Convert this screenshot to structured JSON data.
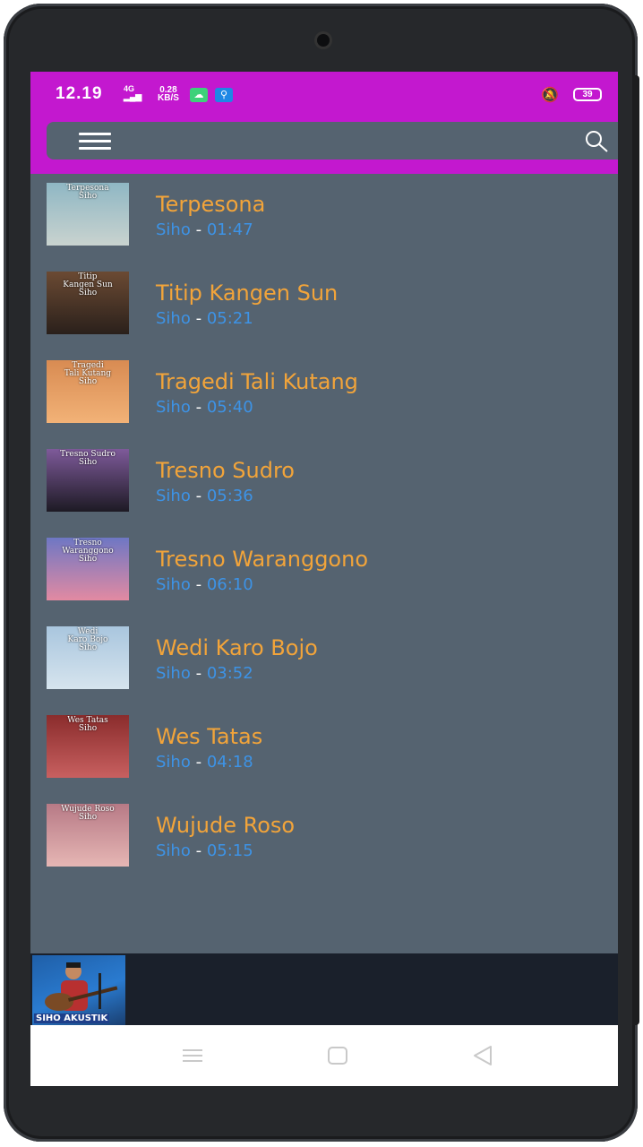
{
  "status_bar": {
    "time": "12.19",
    "network": "4G",
    "speed_value": "0.28",
    "speed_unit": "KB/S",
    "battery": "39"
  },
  "toolbar": {
    "menu_icon": "hamburger-menu-icon",
    "search_icon": "search-icon"
  },
  "songs": [
    {
      "title": "Terpesona",
      "artist": "Siho",
      "separator": "-",
      "duration": "01:47",
      "thumb_text": "Terpesona\nSiho",
      "thumb_colors": [
        "#8fb7c4",
        "#c9d3cf"
      ]
    },
    {
      "title": "Titip Kangen Sun",
      "artist": "Siho",
      "separator": "-",
      "duration": "05:21",
      "thumb_text": "Titip\nKangen Sun\nSiho",
      "thumb_colors": [
        "#6b4a33",
        "#2a201b"
      ]
    },
    {
      "title": "Tragedi Tali Kutang",
      "artist": "Siho",
      "separator": "-",
      "duration": "05:40",
      "thumb_text": "Tragedi\nTali Kutang\nSiho",
      "thumb_colors": [
        "#d88b52",
        "#f2b277"
      ]
    },
    {
      "title": "Tresno Sudro",
      "artist": "Siho",
      "separator": "-",
      "duration": "05:36",
      "thumb_text": "Tresno Sudro\nSiho",
      "thumb_colors": [
        "#7e5a9a",
        "#1d1a24"
      ]
    },
    {
      "title": "Tresno Waranggono",
      "artist": "Siho",
      "separator": "-",
      "duration": "06:10",
      "thumb_text": "Tresno\nWaranggono\nSiho",
      "thumb_colors": [
        "#6e77c4",
        "#e28aa2"
      ]
    },
    {
      "title": "Wedi Karo Bojo",
      "artist": "Siho",
      "separator": "-",
      "duration": "03:52",
      "thumb_text": "Wedi\nKaro Bojo\nSiho",
      "thumb_colors": [
        "#a9c6de",
        "#d6e4ee"
      ]
    },
    {
      "title": "Wes Tatas",
      "artist": "Siho",
      "separator": "-",
      "duration": "04:18",
      "thumb_text": "Wes Tatas\nSiho",
      "thumb_colors": [
        "#8a2c2c",
        "#c86060"
      ]
    },
    {
      "title": "Wujude Roso",
      "artist": "Siho",
      "separator": "-",
      "duration": "05:15",
      "thumb_text": "Wujude Roso\nSiho",
      "thumb_colors": [
        "#b77a86",
        "#e6b6b4"
      ]
    }
  ],
  "player": {
    "caption": "SIHO AKUSTIK"
  },
  "colors": {
    "status_bar": "#c318cf",
    "background": "#556370",
    "title": "#f2a43a",
    "meta": "#3d93e6"
  }
}
